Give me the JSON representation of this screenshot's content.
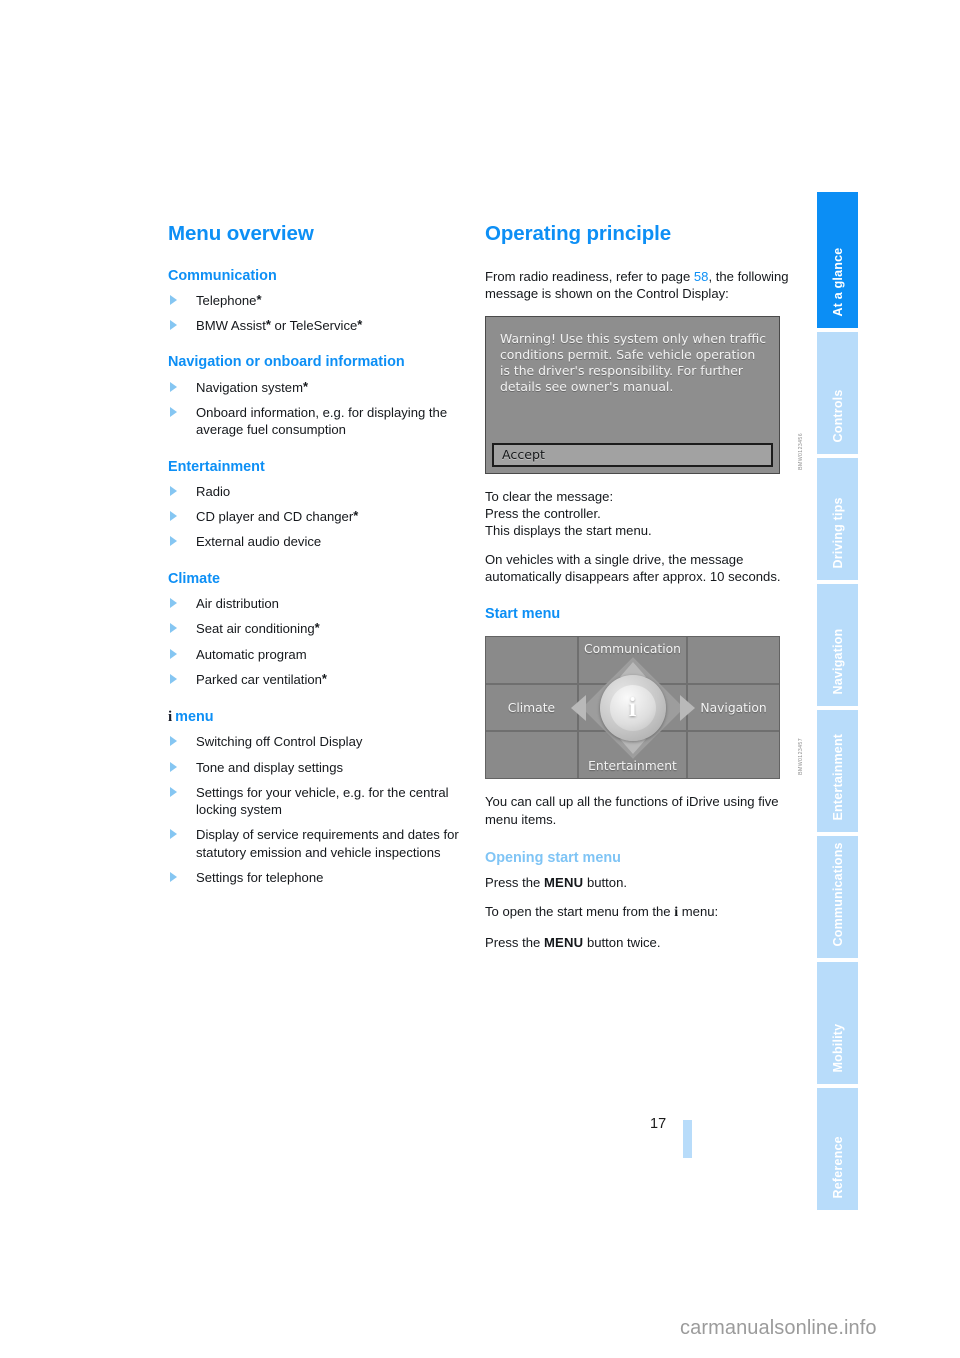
{
  "document": {
    "page_number": "17",
    "watermark": "carmanualsonline.info"
  },
  "tabs": [
    {
      "label": "At a glance",
      "active": true
    },
    {
      "label": "Controls",
      "active": false
    },
    {
      "label": "Driving tips",
      "active": false
    },
    {
      "label": "Navigation",
      "active": false
    },
    {
      "label": "Entertainment",
      "active": false
    },
    {
      "label": "Communications",
      "active": false
    },
    {
      "label": "Mobility",
      "active": false
    },
    {
      "label": "Reference",
      "active": false
    }
  ],
  "left_column": {
    "title": "Menu overview",
    "sections": [
      {
        "heading": "Communication",
        "items": [
          {
            "text": "Telephone",
            "star": "*"
          },
          {
            "text": "BMW Assist",
            "star": "*",
            "text2": " or TeleService",
            "star2": "*"
          }
        ]
      },
      {
        "heading": "Navigation or onboard information",
        "items": [
          {
            "text": "Navigation system",
            "star": "*"
          },
          {
            "text": "Onboard information, e.g. for displaying the average fuel consumption",
            "star": ""
          }
        ]
      },
      {
        "heading": "Entertainment",
        "items": [
          {
            "text": "Radio",
            "star": ""
          },
          {
            "text": "CD player and CD changer",
            "star": "*"
          },
          {
            "text": "External audio device",
            "star": ""
          }
        ]
      },
      {
        "heading": "Climate",
        "items": [
          {
            "text": "Air distribution",
            "star": ""
          },
          {
            "text": "Seat air conditioning",
            "star": "*"
          },
          {
            "text": "Automatic program",
            "star": ""
          },
          {
            "text": "Parked car ventilation",
            "star": "*"
          }
        ]
      },
      {
        "heading_icon": "i",
        "heading": "menu",
        "items": [
          {
            "text": "Switching off Control Display",
            "star": ""
          },
          {
            "text": "Tone and display settings",
            "star": ""
          },
          {
            "text": "Settings for your vehicle, e.g. for the central locking system",
            "star": ""
          },
          {
            "text": "Display of service requirements and dates for statutory emission and vehicle inspections",
            "star": ""
          },
          {
            "text": "Settings for telephone",
            "star": ""
          }
        ]
      }
    ]
  },
  "right_column": {
    "title": "Operating principle",
    "intro_before_link": "From radio readiness, refer to page ",
    "intro_link": "58",
    "intro_after_link": ", the following message is shown on the Control Display:",
    "warning_figure": {
      "name": "control-display-warning",
      "message": "Warning! Use this system only when traffic conditions permit. Safe vehicle operation is the driver's responsibility. For further details see owner's manual.",
      "accept_label": "Accept",
      "figure_code": "BMW0123456"
    },
    "clear_instructions": "To clear the message:\nPress the controller.\nThis displays the start menu.",
    "clear_instructions_lines": [
      "To clear the message:",
      "Press the controller.",
      "This displays the start menu."
    ],
    "single_drive_note": "On vehicles with a single drive, the message automatically disappears after approx. 10 seconds.",
    "start_menu_heading": "Start menu",
    "start_menu_figure": {
      "name": "idrive-start-menu",
      "center_icon": "i",
      "cells": [
        {
          "label": "",
          "position": "top-left"
        },
        {
          "label": "Communication",
          "position": "top-center"
        },
        {
          "label": "",
          "position": "top-right"
        },
        {
          "label": "Climate",
          "position": "middle-left"
        },
        {
          "label": "",
          "position": "middle-center"
        },
        {
          "label": "Navigation",
          "position": "middle-right"
        },
        {
          "label": "",
          "position": "bottom-left"
        },
        {
          "label": "Entertainment",
          "position": "bottom-center"
        },
        {
          "label": "",
          "position": "bottom-right"
        }
      ],
      "figure_code": "BMW0123457"
    },
    "menu_items_note": "You can call up all the functions of iDrive using five menu items.",
    "opening_heading": "Opening start menu",
    "opening_line1_before": "Press the ",
    "opening_line1_key": "MENU",
    "opening_line1_after": " button.",
    "opening_line2_before": "To open the start menu from the ",
    "opening_line2_icon": "i",
    "opening_line2_after": " menu:",
    "opening_line3_before": "Press the ",
    "opening_line3_key": "MENU",
    "opening_line3_after": " button twice."
  },
  "colors": {
    "heading_blue": "#0d8ff5",
    "light_blue": "#7fc4f5",
    "tab_inactive": "#b8dcfa",
    "tab_active": "#0b8ef5",
    "body_text": "#15181c"
  }
}
